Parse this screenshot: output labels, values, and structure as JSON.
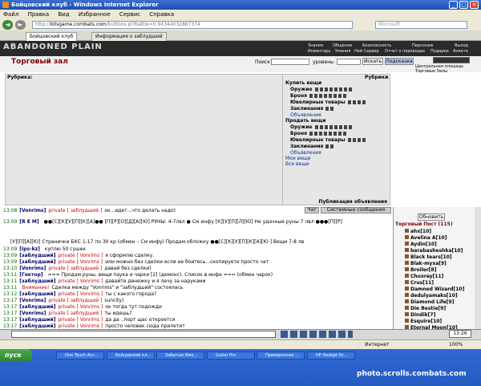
{
  "window": {
    "title": "Бойцовский клуб - Windows Internet Explorer"
  },
  "menu": [
    "Файл",
    "Правка",
    "Вид",
    "Избранное",
    "Сервис",
    "Справка"
  ],
  "address": {
    "url_prefix": "http://",
    "domain": "lotsgame.combats.com",
    "url_rest": "/buttons.pl?battle=0.94344032887374",
    "search": "Microsoft"
  },
  "tabs": [
    {
      "label": "Бойцовский клуб"
    },
    {
      "label": "Информация о заблудший"
    }
  ],
  "game": {
    "logo": "ABANDONED PLAIN",
    "nav_top": [
      "Знания",
      "Общение",
      "Безопасность",
      "Персонаж",
      "Выход"
    ],
    "nav_bottom": [
      "Инвентарь",
      "Умения",
      "Ней Сервер",
      "Отчет о переводах",
      "Подарки",
      "Анкета"
    ],
    "hall_title": "Торговый зал",
    "search_label": "Поиск",
    "level_label": "уровень:",
    "search_button": "Искать",
    "hint_button": "Подсказка",
    "location_links": [
      "Центральная площадь",
      "Торговые Залы"
    ]
  },
  "left_panel": {
    "header": "Рубрика:"
  },
  "right_panel": {
    "header": "Рубрики",
    "buy_header": "Купить вещи",
    "buy_items": [
      "Оружие",
      "Броня",
      "Ювелирные товары",
      "Заклинания"
    ],
    "buy_ads": "Объявления",
    "sell_header": "Продать вещи",
    "sell_items": [
      "Оружие",
      "Броня",
      "Ювелирные товары",
      "Заклинания"
    ],
    "sell_ads": "Объявления",
    "my_items": "Мои вещи",
    "all_items": "Все вещи",
    "ads_label": "Публикация объявления"
  },
  "chat_tabs": {
    "chat": "Чат",
    "system": "Системные сообщения"
  },
  "chat_lines": [
    {
      "time": "13:08",
      "nick": "[Vonrims]",
      "tag": "private [ заблудший ]",
      "text": "ок...идет...что делать надо)"
    },
    {
      "time": "13:09",
      "nick": "[R E M]",
      "tag": "",
      "text": "●●[С][К][У][П][К][А]●● [П][Р][О][Д][А][Ю] РУНЫ: 4-7лвл ● См инфу [К][У][П][Л][Ю] Не удачные руны 7 лвл ●●●[П][Р]"
    },
    {
      "time": "",
      "nick": "",
      "tag": "",
      "text": "[У][П][А][Ю] Странички БКС 1-17 по 30 кр (обмен – См инфу) Продам обложку     ●●[С][К][У][П][К][А][Ю ] Вещи 7-8 лв"
    },
    {
      "time": "13:09",
      "nick": "[Ips-kz]",
      "tag": "",
      "text": "куплю 50 сушек"
    },
    {
      "time": "13:09",
      "nick": "[заблудший]",
      "tag": "private [ Vonrims ]",
      "text": "я сформлю сделку."
    },
    {
      "time": "13:09",
      "nick": "[заблудший]",
      "tag": "private [ Vonrims ]",
      "text": "или можно без сделки если не боитесь...скопируете просто чат"
    },
    {
      "time": "13:10",
      "nick": "[Vonrims]",
      "tag": "private [ заблудший ]",
      "text": "давай без сделки)"
    },
    {
      "time": "13:11",
      "nick": "[Гектор]",
      "tag": "",
      "text": "=== Продам руны, вещи паука и чарки [2] (демонс). Список в инфе === (обмен чарок)"
    },
    {
      "time": "13:11",
      "nick": "[заблудший]",
      "tag": "private [ Vonrims ]",
      "text": "давайте денежку и я лечу за наруками"
    },
    {
      "time": "13:11",
      "nick": "",
      "tag": "Внимание!",
      "text": "Сделка между \"Vonrims\" и \"заблудший\" состоялась"
    },
    {
      "time": "13:12",
      "nick": "[заблудший]",
      "tag": "private [ Vonrims ]",
      "text": "ты с какого города?"
    },
    {
      "time": "13:17",
      "nick": "[Vonrims]",
      "tag": "private [ заблудший ]",
      "text": "suncity)"
    },
    {
      "time": "13:17",
      "nick": "[заблудший]",
      "tag": "private [ Vonrims ]",
      "text": "ок тогда тут подожди"
    },
    {
      "time": "13:17",
      "nick": "[Vonrims]",
      "tag": "private [ заблудший ]",
      "text": "ты идешь?"
    },
    {
      "time": "13:17",
      "nick": "[заблудший]",
      "tag": "private [ Vonrims ]",
      "text": "да да ..порт щас откроется"
    },
    {
      "time": "13:17",
      "nick": "[заблудший]",
      "tag": "private [ Vonrims ]",
      "text": "просто человек сюда прилетит"
    },
    {
      "time": "13:19",
      "nick": "[Vonrims]",
      "tag": "private [ заблудший ]",
      "text": "ок"
    },
    {
      "time": "13:26",
      "nick": "[Vonrims]",
      "tag": "private [ заблудший ]",
      "text": "ну чё там?"
    }
  ],
  "sidebar": {
    "refresh": "Обновить",
    "title": "Торговый Пост (115)",
    "users": [
      "ahx[10]",
      "Avelina A[10]",
      "Aydin[10]",
      "barabasheshka[10]",
      "Black tears[10]",
      "Blak-myxa[9]",
      "Broiler[8]",
      "Chuxray[11]",
      "Crus[11]",
      "Damned Wizard[10]",
      "dedulyamaks[10]",
      "Diamond Life[9]",
      "Die Bestie[9]",
      "Dindik[7]",
      "Esquire[10]",
      "Eternal Moon[10]"
    ]
  },
  "chatbar": {
    "time": "13:26"
  },
  "statusbar": {
    "zone": "Интернет",
    "zoom": "100%"
  },
  "taskbar": {
    "start": "пуск",
    "items": [
      "One Touch Acc...",
      "Бойцовский кл...",
      "Забытые Име...",
      "Guitar Pro",
      "Примерочная ...",
      "HP Deskjet Dr..."
    ],
    "watermark": "photo.scrolls.combats.com"
  }
}
